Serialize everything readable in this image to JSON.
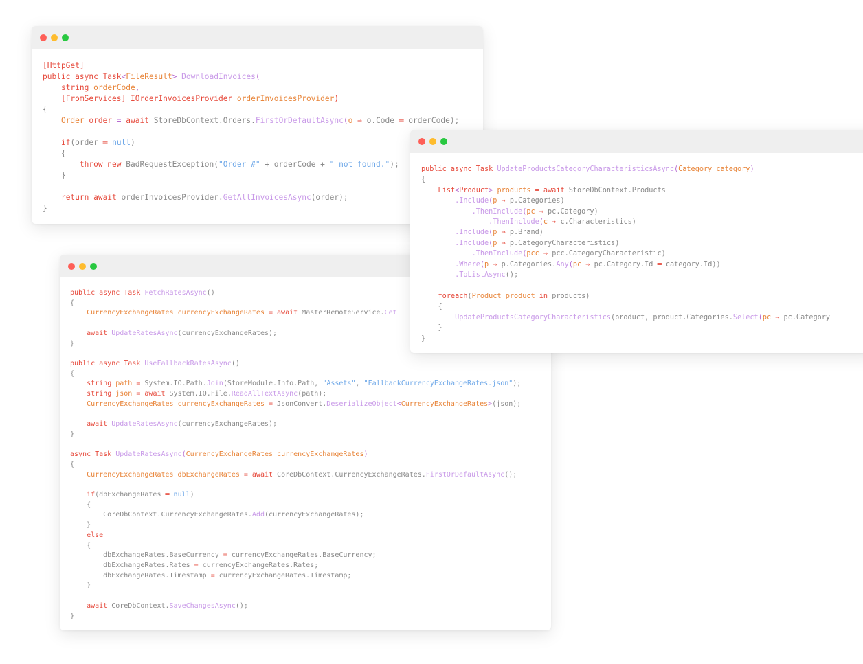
{
  "windows": [
    {
      "name": "download-invoices-window",
      "lines": [
        [
          [
            "k",
            "[HttpGet]"
          ]
        ],
        [
          [
            "k",
            "public async "
          ],
          [
            "k",
            "Task"
          ],
          [
            "o",
            "<"
          ],
          [
            "t",
            "FileResult"
          ],
          [
            "o",
            "> "
          ],
          [
            "f",
            "DownloadInvoices"
          ],
          [
            "o",
            "("
          ]
        ],
        [
          [
            "p",
            "    "
          ],
          [
            "k",
            "string "
          ],
          [
            "t",
            "orderCode"
          ],
          [
            "o",
            ","
          ]
        ],
        [
          [
            "p",
            "    "
          ],
          [
            "k",
            "[FromServices] IOrderInvoicesProvider "
          ],
          [
            "t",
            "orderInvoicesProvider"
          ],
          [
            "k",
            ")"
          ]
        ],
        [
          [
            "p",
            "{"
          ]
        ],
        [
          [
            "p",
            "    "
          ],
          [
            "t",
            "Order "
          ],
          [
            "k",
            "order "
          ],
          [
            "o",
            "= "
          ],
          [
            "k",
            "await "
          ],
          [
            "p",
            "StoreDbContext.Orders."
          ],
          [
            "f",
            "FirstOrDefaultAsync"
          ],
          [
            "o",
            "("
          ],
          [
            "t",
            "o "
          ],
          [
            "k",
            "⇒ "
          ],
          [
            "p",
            "o.Code "
          ],
          [
            "k",
            "═ "
          ],
          [
            "p",
            "orderCode);"
          ]
        ],
        [],
        [
          [
            "p",
            "    "
          ],
          [
            "k",
            "if"
          ],
          [
            "p",
            "(order "
          ],
          [
            "k",
            "═ "
          ],
          [
            "s",
            "null"
          ],
          [
            "p",
            ")"
          ]
        ],
        [
          [
            "p",
            "    {"
          ]
        ],
        [
          [
            "p",
            "        "
          ],
          [
            "k",
            "throw new "
          ],
          [
            "p",
            "BadRequestException("
          ],
          [
            "s",
            "\"Order #\""
          ],
          [
            "p",
            " + orderCode + "
          ],
          [
            "s",
            "\" not found.\""
          ],
          [
            "p",
            ");"
          ]
        ],
        [
          [
            "p",
            "    }"
          ]
        ],
        [],
        [
          [
            "p",
            "    "
          ],
          [
            "k",
            "return await "
          ],
          [
            "p",
            "orderInvoicesProvider."
          ],
          [
            "f",
            "GetAllInvoicesAsync"
          ],
          [
            "p",
            "(order);"
          ]
        ],
        [
          [
            "p",
            "}"
          ]
        ]
      ]
    },
    {
      "name": "update-products-window",
      "lines": [
        [
          [
            "k",
            "public async "
          ],
          [
            "k",
            "Task "
          ],
          [
            "f",
            "UpdateProductsCategoryCharacteristicsAsync"
          ],
          [
            "o",
            "("
          ],
          [
            "t",
            "Category "
          ],
          [
            "t",
            "category"
          ],
          [
            "o",
            ")"
          ]
        ],
        [
          [
            "p",
            "{"
          ]
        ],
        [
          [
            "p",
            "    "
          ],
          [
            "k",
            "List"
          ],
          [
            "o",
            "<"
          ],
          [
            "k",
            "Product"
          ],
          [
            "o",
            "> "
          ],
          [
            "t",
            "products "
          ],
          [
            "k",
            "= await "
          ],
          [
            "p",
            "StoreDbContext.Products"
          ]
        ],
        [
          [
            "p",
            "        "
          ],
          [
            "f",
            ".Include"
          ],
          [
            "o",
            "("
          ],
          [
            "t",
            "p "
          ],
          [
            "k",
            "⇒ "
          ],
          [
            "p",
            "p.Categories)"
          ]
        ],
        [
          [
            "p",
            "            "
          ],
          [
            "f",
            ".ThenInclude"
          ],
          [
            "o",
            "("
          ],
          [
            "t",
            "pc "
          ],
          [
            "k",
            "⇒ "
          ],
          [
            "p",
            "pc.Category)"
          ]
        ],
        [
          [
            "p",
            "                "
          ],
          [
            "f",
            ".ThenInclude"
          ],
          [
            "o",
            "("
          ],
          [
            "t",
            "c "
          ],
          [
            "k",
            "⇒ "
          ],
          [
            "p",
            "c.Characteristics)"
          ]
        ],
        [
          [
            "p",
            "        "
          ],
          [
            "f",
            ".Include"
          ],
          [
            "o",
            "("
          ],
          [
            "t",
            "p "
          ],
          [
            "k",
            "⇒ "
          ],
          [
            "p",
            "p.Brand)"
          ]
        ],
        [
          [
            "p",
            "        "
          ],
          [
            "f",
            ".Include"
          ],
          [
            "o",
            "("
          ],
          [
            "t",
            "p "
          ],
          [
            "k",
            "⇒ "
          ],
          [
            "p",
            "p.CategoryCharacteristics)"
          ]
        ],
        [
          [
            "p",
            "            "
          ],
          [
            "f",
            ".ThenInclude"
          ],
          [
            "o",
            "("
          ],
          [
            "t",
            "pcc "
          ],
          [
            "k",
            "⇒ "
          ],
          [
            "p",
            "pcc.CategoryCharacteristic)"
          ]
        ],
        [
          [
            "p",
            "        "
          ],
          [
            "f",
            ".Where"
          ],
          [
            "o",
            "("
          ],
          [
            "t",
            "p "
          ],
          [
            "k",
            "⇒ "
          ],
          [
            "p",
            "p.Categories."
          ],
          [
            "f",
            "Any"
          ],
          [
            "o",
            "("
          ],
          [
            "t",
            "pc "
          ],
          [
            "k",
            "⇒ "
          ],
          [
            "p",
            "pc.Category.Id "
          ],
          [
            "k",
            "═ "
          ],
          [
            "p",
            "category.Id))"
          ]
        ],
        [
          [
            "p",
            "        "
          ],
          [
            "f",
            ".ToListAsync"
          ],
          [
            "p",
            "();"
          ]
        ],
        [],
        [
          [
            "p",
            "    "
          ],
          [
            "k",
            "foreach"
          ],
          [
            "p",
            "("
          ],
          [
            "t",
            "Product "
          ],
          [
            "t",
            "product "
          ],
          [
            "k",
            "in "
          ],
          [
            "p",
            "products)"
          ]
        ],
        [
          [
            "p",
            "    {"
          ]
        ],
        [
          [
            "p",
            "        "
          ],
          [
            "f",
            "UpdateProductsCategoryCharacteristics"
          ],
          [
            "p",
            "(product, product.Categories."
          ],
          [
            "f",
            "Select"
          ],
          [
            "o",
            "("
          ],
          [
            "t",
            "pc "
          ],
          [
            "k",
            "⇒ "
          ],
          [
            "p",
            "pc.Category"
          ]
        ],
        [
          [
            "p",
            "    }"
          ]
        ],
        [
          [
            "p",
            "}"
          ]
        ]
      ]
    },
    {
      "name": "currency-rates-window",
      "lines": [
        [
          [
            "k",
            "public async "
          ],
          [
            "k",
            "Task "
          ],
          [
            "f",
            "FetchRatesAsync"
          ],
          [
            "p",
            "()"
          ]
        ],
        [
          [
            "p",
            "{"
          ]
        ],
        [
          [
            "p",
            "    "
          ],
          [
            "t",
            "CurrencyExchangeRates "
          ],
          [
            "t",
            "currencyExchangeRates "
          ],
          [
            "k",
            "= await "
          ],
          [
            "p",
            "MasterRemoteService."
          ],
          [
            "f",
            "Get"
          ]
        ],
        [],
        [
          [
            "p",
            "    "
          ],
          [
            "k",
            "await "
          ],
          [
            "f",
            "UpdateRatesAsync"
          ],
          [
            "p",
            "(currencyExchangeRates);"
          ]
        ],
        [
          [
            "p",
            "}"
          ]
        ],
        [],
        [
          [
            "k",
            "public async "
          ],
          [
            "k",
            "Task "
          ],
          [
            "f",
            "UseFallbackRatesAsync"
          ],
          [
            "p",
            "()"
          ]
        ],
        [
          [
            "p",
            "{"
          ]
        ],
        [
          [
            "p",
            "    "
          ],
          [
            "k",
            "string "
          ],
          [
            "t",
            "path "
          ],
          [
            "k",
            "= "
          ],
          [
            "p",
            "System.IO.Path."
          ],
          [
            "f",
            "Join"
          ],
          [
            "p",
            "(StoreModule.Info.Path, "
          ],
          [
            "s",
            "\"Assets\""
          ],
          [
            "p",
            ", "
          ],
          [
            "s",
            "\"FallbackCurrencyExchangeRates.json\""
          ],
          [
            "p",
            ");"
          ]
        ],
        [
          [
            "p",
            "    "
          ],
          [
            "k",
            "string "
          ],
          [
            "t",
            "json "
          ],
          [
            "k",
            "= await "
          ],
          [
            "p",
            "System.IO.File."
          ],
          [
            "f",
            "ReadAllTextAsync"
          ],
          [
            "p",
            "(path);"
          ]
        ],
        [
          [
            "p",
            "    "
          ],
          [
            "t",
            "CurrencyExchangeRates "
          ],
          [
            "t",
            "currencyExchangeRates "
          ],
          [
            "k",
            "= "
          ],
          [
            "p",
            "JsonConvert."
          ],
          [
            "f",
            "DeserializeObject"
          ],
          [
            "o",
            "<"
          ],
          [
            "t",
            "CurrencyExchangeRates"
          ],
          [
            "o",
            ">"
          ],
          [
            "p",
            "(json);"
          ]
        ],
        [],
        [
          [
            "p",
            "    "
          ],
          [
            "k",
            "await "
          ],
          [
            "f",
            "UpdateRatesAsync"
          ],
          [
            "p",
            "(currencyExchangeRates);"
          ]
        ],
        [
          [
            "p",
            "}"
          ]
        ],
        [],
        [
          [
            "k",
            "async "
          ],
          [
            "k",
            "Task "
          ],
          [
            "f",
            "UpdateRatesAsync"
          ],
          [
            "o",
            "("
          ],
          [
            "t",
            "CurrencyExchangeRates "
          ],
          [
            "t",
            "currencyExchangeRates"
          ],
          [
            "o",
            ")"
          ]
        ],
        [
          [
            "p",
            "{"
          ]
        ],
        [
          [
            "p",
            "    "
          ],
          [
            "t",
            "CurrencyExchangeRates "
          ],
          [
            "t",
            "dbExchangeRates "
          ],
          [
            "k",
            "= await "
          ],
          [
            "p",
            "CoreDbContext.CurrencyExchangeRates."
          ],
          [
            "f",
            "FirstOrDefaultAsync"
          ],
          [
            "p",
            "();"
          ]
        ],
        [],
        [
          [
            "p",
            "    "
          ],
          [
            "k",
            "if"
          ],
          [
            "p",
            "(dbExchangeRates "
          ],
          [
            "k",
            "═ "
          ],
          [
            "s",
            "null"
          ],
          [
            "p",
            ")"
          ]
        ],
        [
          [
            "p",
            "    {"
          ]
        ],
        [
          [
            "p",
            "        CoreDbContext.CurrencyExchangeRates."
          ],
          [
            "f",
            "Add"
          ],
          [
            "p",
            "(currencyExchangeRates);"
          ]
        ],
        [
          [
            "p",
            "    }"
          ]
        ],
        [
          [
            "p",
            "    "
          ],
          [
            "k",
            "else"
          ]
        ],
        [
          [
            "p",
            "    {"
          ]
        ],
        [
          [
            "p",
            "        dbExchangeRates.BaseCurrency "
          ],
          [
            "k",
            "= "
          ],
          [
            "p",
            "currencyExchangeRates.BaseCurrency;"
          ]
        ],
        [
          [
            "p",
            "        dbExchangeRates.Rates "
          ],
          [
            "k",
            "= "
          ],
          [
            "p",
            "currencyExchangeRates.Rates;"
          ]
        ],
        [
          [
            "p",
            "        dbExchangeRates.Timestamp "
          ],
          [
            "k",
            "= "
          ],
          [
            "p",
            "currencyExchangeRates.Timestamp;"
          ]
        ],
        [
          [
            "p",
            "    }"
          ]
        ],
        [],
        [
          [
            "p",
            "    "
          ],
          [
            "k",
            "await "
          ],
          [
            "p",
            "CoreDbContext."
          ],
          [
            "f",
            "SaveChangesAsync"
          ],
          [
            "p",
            "();"
          ]
        ],
        [
          [
            "p",
            "}"
          ]
        ]
      ]
    }
  ]
}
